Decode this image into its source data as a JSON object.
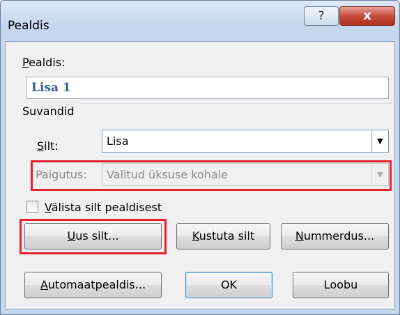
{
  "dialog": {
    "title": "Pealdis",
    "help_glyph": "?",
    "close_glyph": "x",
    "caption": {
      "label_u": "P",
      "label_rest": "ealdis:",
      "value": "Lisa 1"
    },
    "options_header": "Suvandid",
    "label_field": {
      "label_u": "S",
      "label_rest": "ilt:",
      "value": "Lisa"
    },
    "position_field": {
      "label": "Paigutus:",
      "value": "Valitud üksuse kohale"
    },
    "exclude_checkbox": {
      "label_u": "V",
      "label_rest": "älista silt pealdisest",
      "checked": false
    },
    "buttons": {
      "new_label_u": "U",
      "new_label_rest": "us silt...",
      "delete_label_u": "K",
      "delete_label_rest": "ustuta silt",
      "numbering_u": "N",
      "numbering_rest": "ummerdus...",
      "autocaption_u": "A",
      "autocaption_rest": "utomaatpealdis...",
      "ok": "OK",
      "cancel": "Loobu"
    },
    "dropdown_arrow": "▼",
    "highlight_color": "#e8212c",
    "caption_text_color": "#365f91"
  }
}
